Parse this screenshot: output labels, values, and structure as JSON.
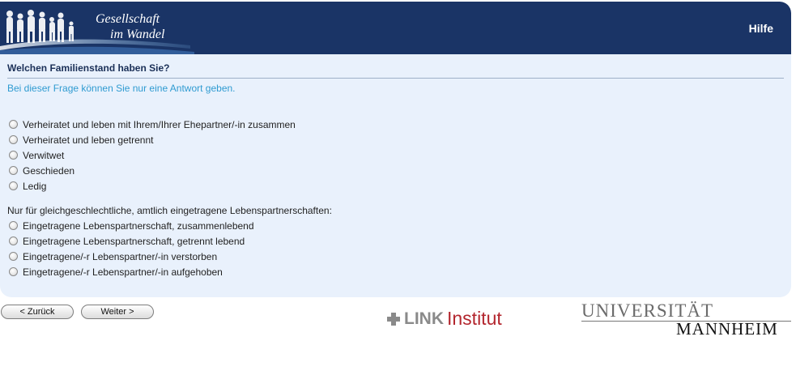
{
  "header": {
    "logo_line1": "Gesellschaft",
    "logo_line2": "im Wandel",
    "help": "Hilfe"
  },
  "question": {
    "title": "Welchen Familienstand haben Sie?",
    "instruction": "Bei dieser Frage können Sie nur eine Antwort geben.",
    "options": [
      "Verheiratet und leben mit Ihrem/Ihrer Ehepartner/-in zusammen",
      "Verheiratet und leben getrennt",
      "Verwitwet",
      "Geschieden",
      "Ledig"
    ],
    "section_label": "Nur für gleichgeschlechtliche, amtlich eingetragene Lebenspartnerschaften:",
    "partnership_options": [
      "Eingetragene Lebenspartnerschaft, zusammenlebend",
      "Eingetragene Lebenspartnerschaft, getrennt lebend",
      "Eingetragene/-r Lebenspartner/-in verstorben",
      "Eingetragene/-r Lebenspartner/-in aufgehoben"
    ]
  },
  "nav": {
    "back": "< Zurück",
    "next": "Weiter >"
  },
  "footer": {
    "link_bold": "LINK",
    "link_institut": "Institut",
    "uni_line1": "UNIVERSITÄT",
    "uni_line2": "MANNHEIM"
  }
}
